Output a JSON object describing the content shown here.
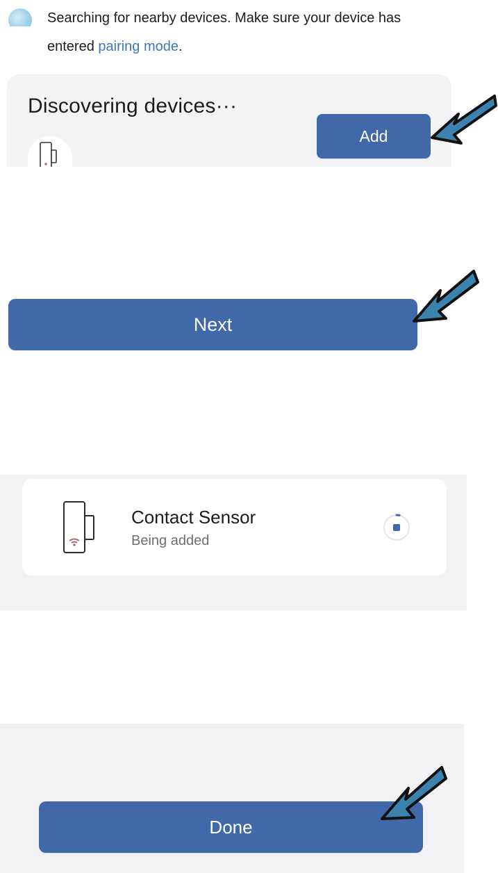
{
  "search_message": {
    "text_before": "Searching for nearby devices. Make sure your device has entered ",
    "link": "pairing mode",
    "text_after": "."
  },
  "discover": {
    "title": "Discovering devices···",
    "add_label": "Add"
  },
  "next_label": "Next",
  "device": {
    "name": "Contact Sensor",
    "status": "Being added"
  },
  "done_label": "Done",
  "colors": {
    "accent": "#4169a9",
    "link": "#3d77b5",
    "arrow": "#3c82ae",
    "panel": "#f3f3f5"
  },
  "icons": [
    "search-dot-icon",
    "contact-sensor-icon",
    "loading-spinner-icon",
    "pointer-arrow-icon"
  ]
}
